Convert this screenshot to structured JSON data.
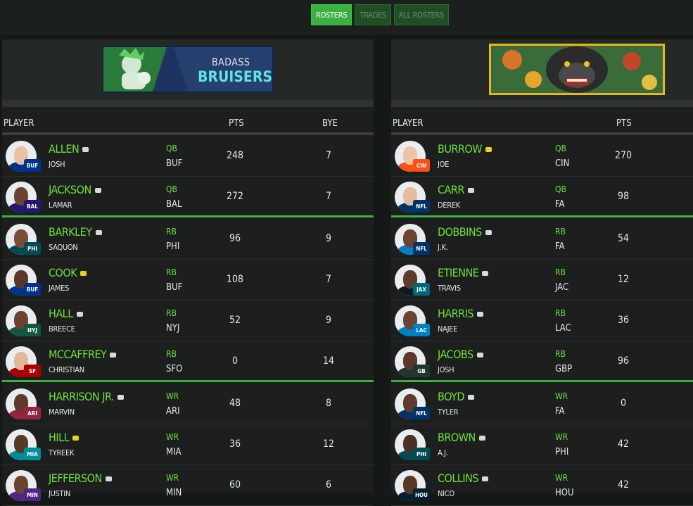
{
  "tabs": [
    {
      "label": "ROSTERS",
      "active": true
    },
    {
      "label": "TRADES",
      "active": false
    },
    {
      "label": "ALL ROSTERS",
      "active": false
    }
  ],
  "left": {
    "logo_text_1": "BADASS",
    "logo_text_2": "BRUISERS",
    "headers": {
      "player": "PLAYER",
      "pts": "PTS",
      "bye": "BYE"
    },
    "rows": [
      {
        "last": "ALLEN",
        "first": "JOSH",
        "pos": "QB",
        "team": "BUF",
        "pts": "248",
        "bye": "7",
        "note": "white",
        "logo": "BUF",
        "logo_color": "#00338d",
        "skin": "#e8c3a3",
        "jersey": "#00338d",
        "grpend": false
      },
      {
        "last": "JACKSON",
        "first": "LAMAR",
        "pos": "QB",
        "team": "BAL",
        "pts": "272",
        "bye": "7",
        "note": "white",
        "logo": "BAL",
        "logo_color": "#241773",
        "skin": "#6b4430",
        "jersey": "#241773",
        "grpend": true
      },
      {
        "last": "BARKLEY",
        "first": "SAQUON",
        "pos": "RB",
        "team": "PHI",
        "pts": "96",
        "bye": "9",
        "note": "white",
        "logo": "PHI",
        "logo_color": "#004c54",
        "skin": "#7a4e36",
        "jersey": "#004c54",
        "grpend": false
      },
      {
        "last": "COOK",
        "first": "JAMES",
        "pos": "RB",
        "team": "BUF",
        "pts": "108",
        "bye": "7",
        "note": "yellow",
        "logo": "BUF",
        "logo_color": "#00338d",
        "skin": "#5b3826",
        "jersey": "#00338d",
        "grpend": false
      },
      {
        "last": "HALL",
        "first": "BREECE",
        "pos": "RB",
        "team": "NYJ",
        "pts": "52",
        "bye": "9",
        "note": "white",
        "logo": "NYJ",
        "logo_color": "#125740",
        "skin": "#6a4331",
        "jersey": "#125740",
        "grpend": false
      },
      {
        "last": "MCCAFFREY",
        "first": "CHRISTIAN",
        "pos": "RB",
        "team": "SFO",
        "pts": "0",
        "bye": "14",
        "note": "white",
        "logo": "SF",
        "logo_color": "#aa0000",
        "skin": "#e2b89b",
        "jersey": "#aa0000",
        "grpend": true
      },
      {
        "last": "HARRISON JR.",
        "first": "MARVIN",
        "pos": "WR",
        "team": "ARI",
        "pts": "48",
        "bye": "8",
        "note": "white",
        "logo": "ARI",
        "logo_color": "#97233f",
        "skin": "#5e3b2a",
        "jersey": "#97233f",
        "grpend": false
      },
      {
        "last": "HILL",
        "first": "TYREEK",
        "pos": "WR",
        "team": "MIA",
        "pts": "36",
        "bye": "12",
        "note": "yellow",
        "logo": "MIA",
        "logo_color": "#008e97",
        "skin": "#5a3827",
        "jersey": "#008e97",
        "grpend": false
      },
      {
        "last": "JEFFERSON",
        "first": "JUSTIN",
        "pos": "WR",
        "team": "MIN",
        "pts": "60",
        "bye": "6",
        "note": "white",
        "logo": "MIN",
        "logo_color": "#4f2683",
        "skin": "#6a4331",
        "jersey": "#4f2683",
        "grpend": false
      }
    ]
  },
  "right": {
    "headers": {
      "player": "PLAYER",
      "pts": "PTS"
    },
    "rows": [
      {
        "last": "BURROW",
        "first": "JOE",
        "pos": "QB",
        "team": "CIN",
        "pts": "270",
        "note": "yellow",
        "logo": "CIN",
        "logo_color": "#fb4f14",
        "skin": "#e9c5a6",
        "jersey": "#fb4f14",
        "grpend": false
      },
      {
        "last": "CARR",
        "first": "DEREK",
        "pos": "QB",
        "team": "FA",
        "pts": "98",
        "note": "white",
        "logo": "NFL",
        "logo_color": "#013369",
        "skin": "#e2bc9d",
        "jersey": "#013369",
        "grpend": true
      },
      {
        "last": "DOBBINS",
        "first": "J.K.",
        "pos": "RB",
        "team": "FA",
        "pts": "54",
        "note": "white",
        "logo": "NFL",
        "logo_color": "#013369",
        "skin": "#6b4331",
        "jersey": "#0080c6",
        "grpend": false
      },
      {
        "last": "ETIENNE",
        "first": "TRAVIS",
        "pos": "RB",
        "team": "JAC",
        "pts": "12",
        "note": "white",
        "logo": "JAX",
        "logo_color": "#006778",
        "skin": "#5e3b2a",
        "jersey": "#101820",
        "grpend": false
      },
      {
        "last": "HARRIS",
        "first": "NAJEE",
        "pos": "RB",
        "team": "LAC",
        "pts": "36",
        "note": "white",
        "logo": "LAC",
        "logo_color": "#0080c6",
        "skin": "#6a4331",
        "jersey": "#0080c6",
        "grpend": false
      },
      {
        "last": "JACOBS",
        "first": "JOSH",
        "pos": "RB",
        "team": "GBP",
        "pts": "96",
        "note": "white",
        "logo": "GB",
        "logo_color": "#203731",
        "skin": "#5a3827",
        "jersey": "#203731",
        "grpend": true
      },
      {
        "last": "BOYD",
        "first": "TYLER",
        "pos": "WR",
        "team": "FA",
        "pts": "0",
        "note": "white",
        "logo": "NFL",
        "logo_color": "#013369",
        "skin": "#5e3b2a",
        "jersey": "#013369",
        "grpend": false
      },
      {
        "last": "BROWN",
        "first": "A.J.",
        "pos": "WR",
        "team": "PHI",
        "pts": "42",
        "note": "white",
        "logo": "PHI",
        "logo_color": "#004c54",
        "skin": "#4e3022",
        "jersey": "#004c54",
        "grpend": false
      },
      {
        "last": "COLLINS",
        "first": "NICO",
        "pos": "WR",
        "team": "HOU",
        "pts": "42",
        "note": "white",
        "logo": "HOU",
        "logo_color": "#03202f",
        "skin": "#5a3827",
        "jersey": "#03202f",
        "grpend": false
      }
    ]
  }
}
